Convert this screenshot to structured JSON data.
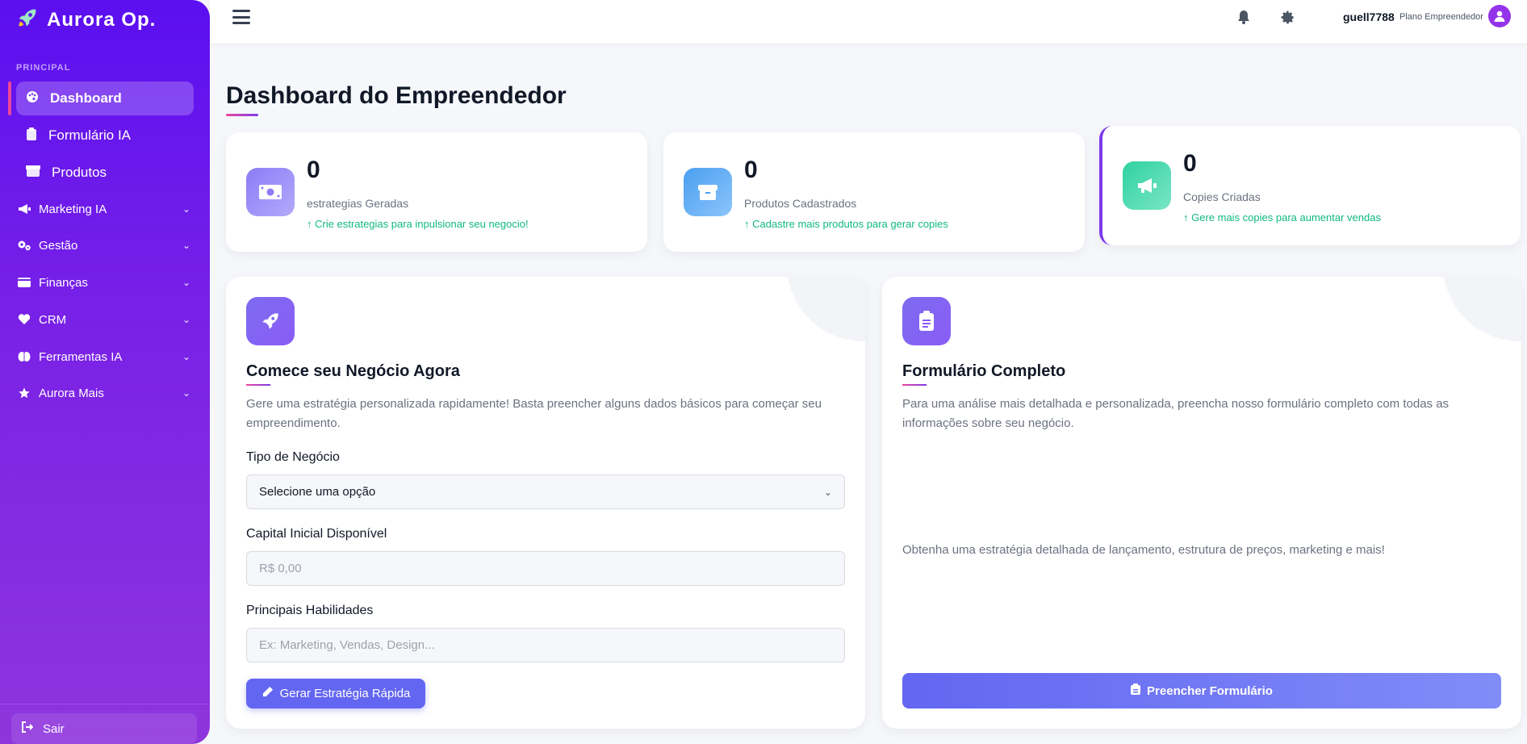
{
  "brand": {
    "name": "Aurora Op.",
    "logo_icon": "rocket-icon"
  },
  "sidebar": {
    "section_label": "PRINCIPAL",
    "primary_items": [
      {
        "label": "Dashboard",
        "icon": "palette-icon",
        "active": true
      },
      {
        "label": "Formulário IA",
        "icon": "clipboard-icon"
      },
      {
        "label": "Produtos",
        "icon": "box-icon"
      }
    ],
    "groups": [
      {
        "label": "Marketing IA",
        "icon": "megaphone-icon"
      },
      {
        "label": "Gestão",
        "icon": "gears-icon"
      },
      {
        "label": "Finanças",
        "icon": "wallet-icon"
      },
      {
        "label": "CRM",
        "icon": "heart-icon"
      },
      {
        "label": "Ferramentas IA",
        "icon": "brain-icon"
      },
      {
        "label": "Aurora Mais",
        "icon": "star-icon"
      }
    ],
    "logout_label": "Sair"
  },
  "topbar": {
    "username": "guell7788",
    "plan": "Plano Empreendedor"
  },
  "page": {
    "title": "Dashboard do Empreendedor"
  },
  "stats": [
    {
      "value": "0",
      "label": "estrategias Geradas",
      "hint": "↑ Crie estrategias para inpulsionar seu negocio!",
      "icon": "money-bill-icon",
      "color": "#8b7cf6"
    },
    {
      "value": "0",
      "label": "Produtos Cadastrados",
      "hint": "↑ Cadastre mais produtos para gerar copies",
      "icon": "box-icon",
      "color": "#4a9ff0"
    },
    {
      "value": "0",
      "label": "Copies Criadas",
      "hint": "↑ Gere mais copies para aumentar vendas",
      "icon": "megaphone-icon",
      "color": "#2fd1a0"
    }
  ],
  "quick_card": {
    "title": "Comece seu Negócio Agora",
    "desc_line1": "Gere uma estratégia personalizada rapidamente! Basta preencher alguns dados básicos para começar seu",
    "desc_line2": "empreendimento.",
    "business_type_label": "Tipo de Negócio",
    "business_type_value": "Selecione uma opção",
    "capital_label": "Capital Inicial Disponível",
    "capital_placeholder": "R$ 0,00",
    "skills_label": "Principais Habilidades",
    "skills_placeholder": "Ex: Marketing, Vendas, Design...",
    "button_label": "Gerar Estratégia Rápida"
  },
  "full_card": {
    "title": "Formulário Completo",
    "desc_line1": "Para uma análise mais detalhada e personalizada, preencha nosso formulário completo com todas as",
    "desc_line2": "informações sobre seu negócio.",
    "extra": "Obtenha uma estratégia detalhada de lançamento, estrutura de preços, marketing e mais!",
    "button_label": "Preencher Formulário"
  },
  "colors": {
    "sidebar_top": "#5b0ff0",
    "sidebar_bottom": "#8f35dc",
    "accent": "#6366f1",
    "success": "#10b981"
  }
}
